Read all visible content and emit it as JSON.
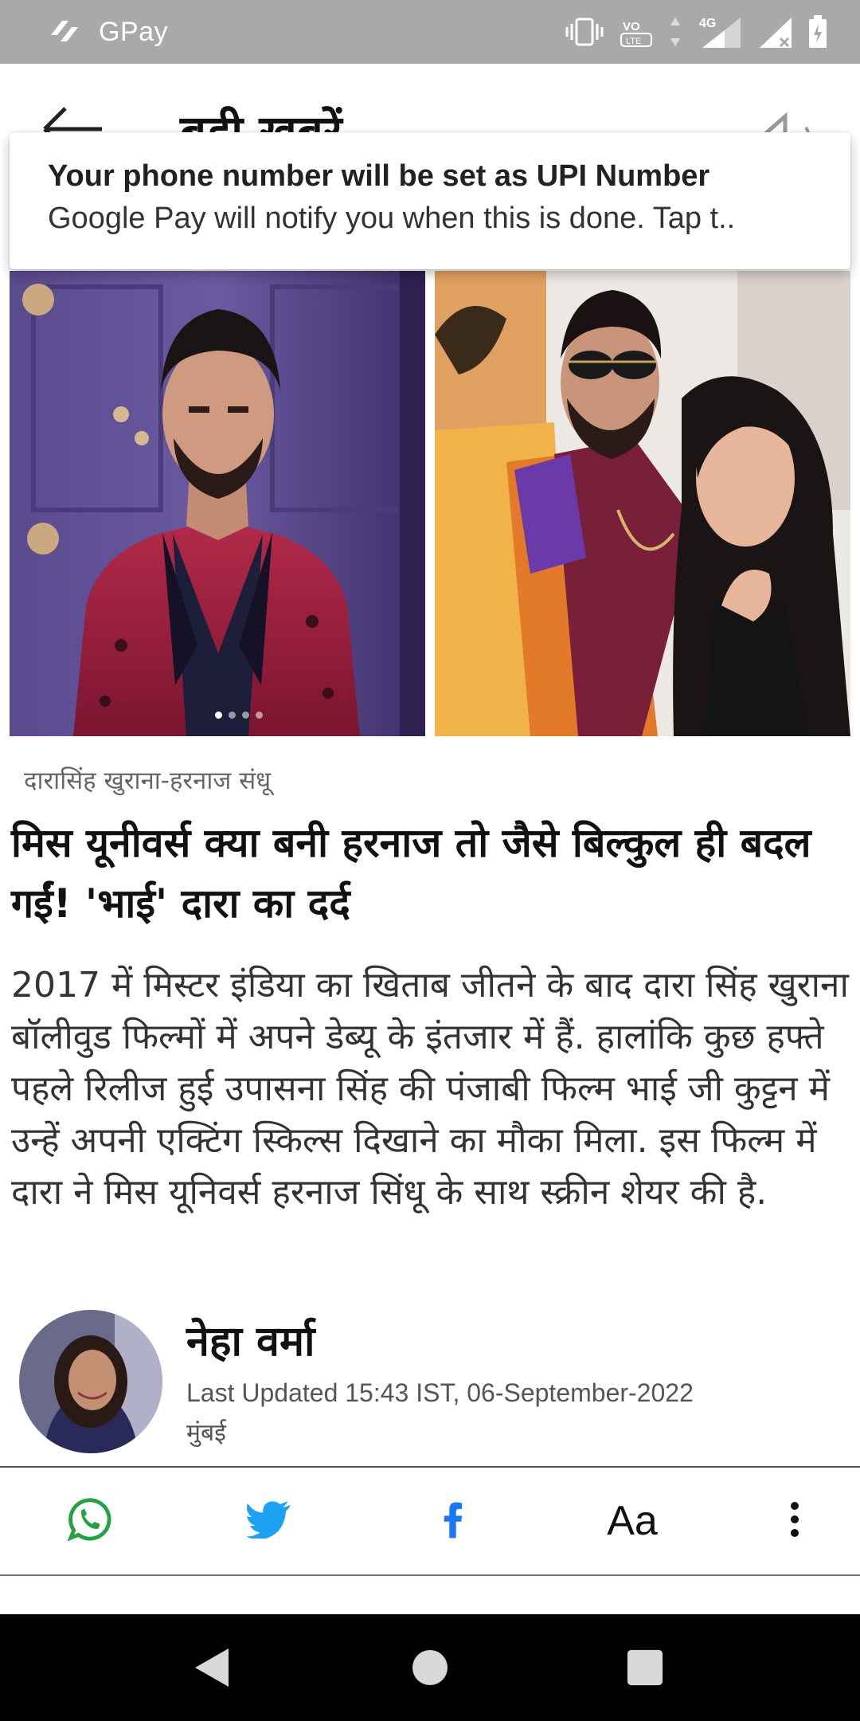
{
  "status_bar": {
    "app_name": "GPay",
    "network": "4G",
    "volte": "VoLTE"
  },
  "header": {
    "title": "बड़ी खबरें"
  },
  "notification": {
    "title": "Your phone number will be set as UPI Number",
    "text": "Google Pay will notify you when this is done. Tap t.."
  },
  "carousel": {
    "total": 4,
    "active_index": 0
  },
  "article": {
    "caption": "दारासिंह खुराना-हरनाज संधू",
    "headline": "मिस यूनीवर्स क्या बनी हरनाज तो जैसे बिल्कुल ही बदल गईं! 'भाई' दारा का दर्द",
    "body": "2017 में मिस्टर इंडिया का खिताब जीतने के बाद दारा सिंह खुराना बॉलीवुड फिल्मों में अपने डेब्यू के इंतजार में हैं. हालांकि कुछ हफ्ते पहले रिलीज हुई उपासना सिंह की पंजाबी फिल्म भाई जी कुट्टन में उन्हें अपनी एक्टिंग स्किल्स दिखाने का मौका मिला. इस फिल्म में दारा ने मिस यूनिवर्स हरनाज सिंधू के साथ स्क्रीन शेयर की है."
  },
  "author": {
    "name": "नेहा वर्मा",
    "updated": "Last Updated 15:43 IST, 06-September-2022",
    "location": "मुंबई"
  },
  "share_bar": {
    "font_size_label": "Aa"
  },
  "colors": {
    "whatsapp": "#25a244",
    "twitter": "#1da1f2",
    "facebook": "#1877f2",
    "status_bar": "#a9a9a9"
  },
  "icons": [
    "gpay-logo-icon",
    "vibrate-icon",
    "volte-icon",
    "data-arrows-icon",
    "signal-icon",
    "battery-icon",
    "back-arrow-icon",
    "speaker-icon",
    "whatsapp-icon",
    "twitter-icon",
    "facebook-icon",
    "more-vertical-icon",
    "nav-back-icon",
    "nav-home-icon",
    "nav-recents-icon"
  ]
}
